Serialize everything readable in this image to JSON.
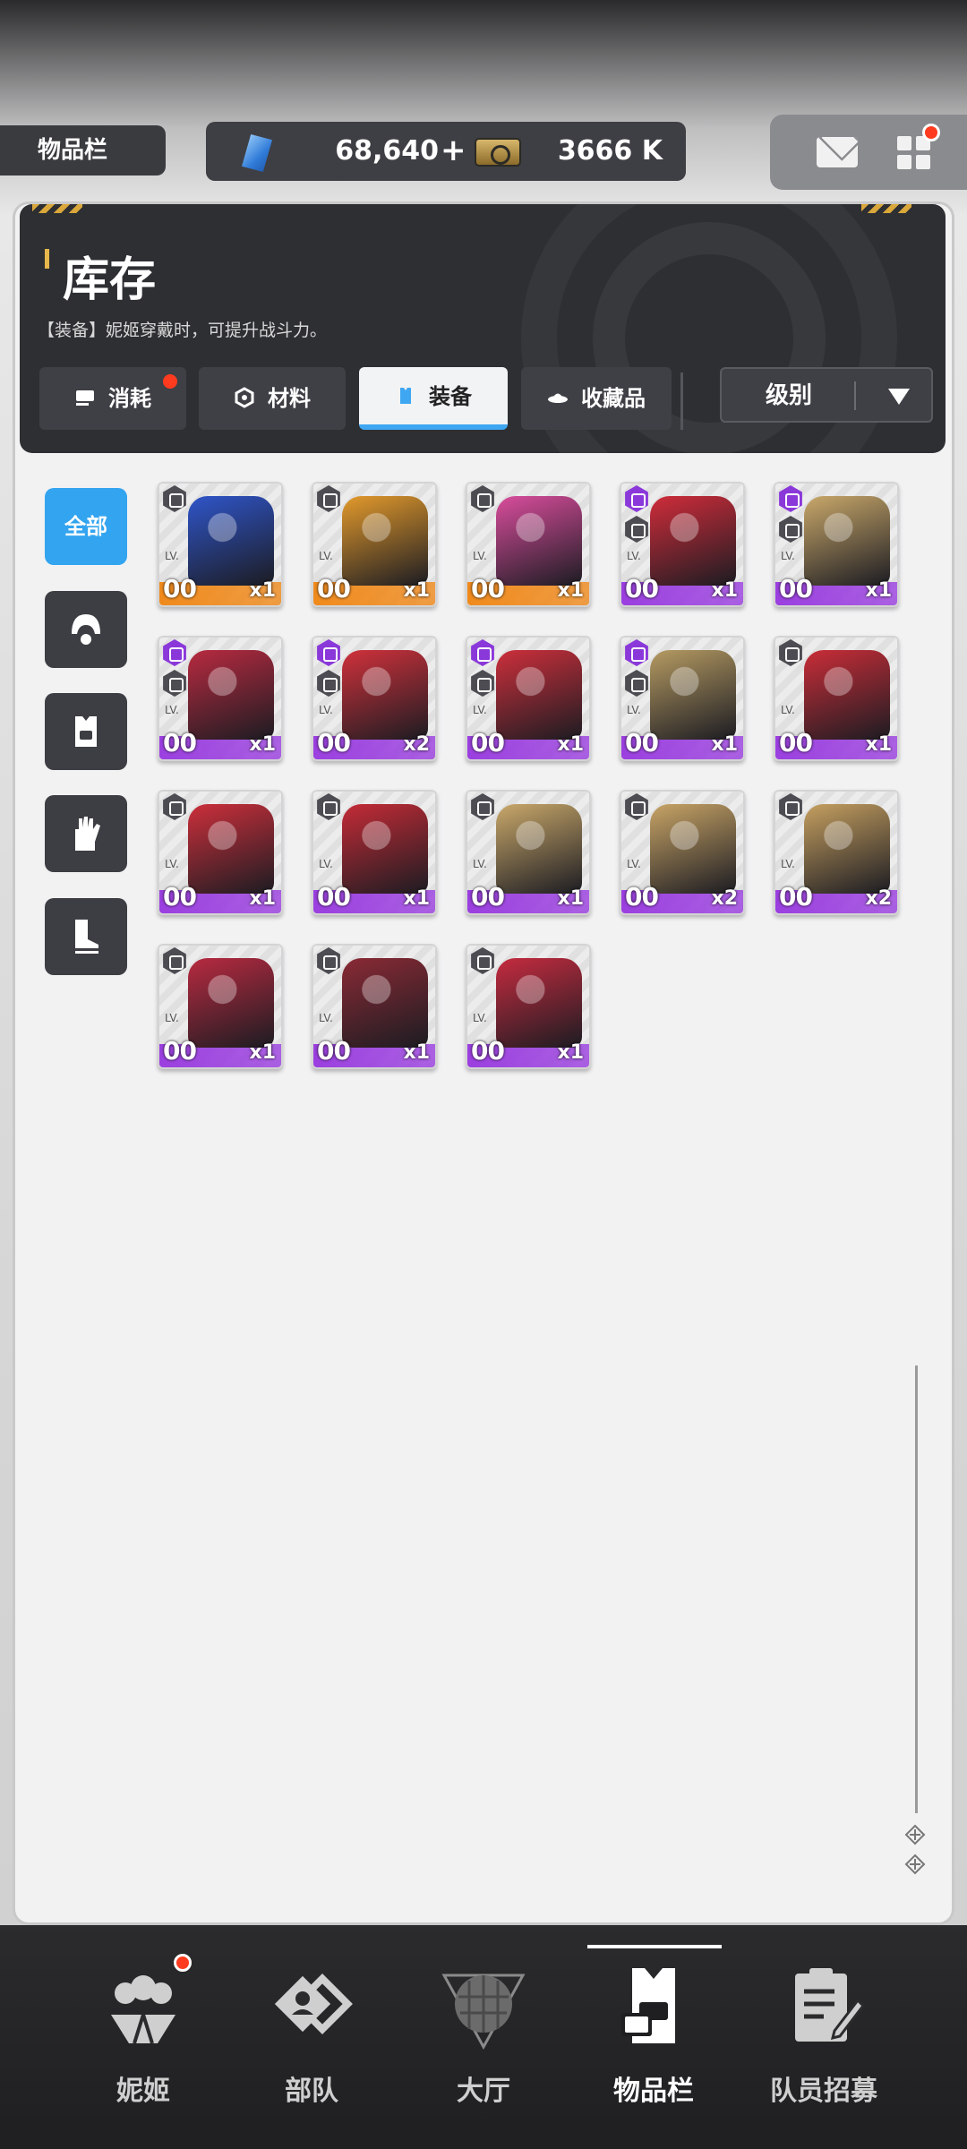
{
  "topbar": {
    "page_tag": "物品栏",
    "gems": "68,640",
    "plus": "+",
    "credits": "3666 K"
  },
  "header": {
    "title": "库存",
    "subtitle": "【装备】妮姬穿戴时，可提升战斗力。",
    "tabs": [
      {
        "label": "消耗",
        "icon": "consumable-icon",
        "active": false,
        "notify": true
      },
      {
        "label": "材料",
        "icon": "material-icon",
        "active": false,
        "notify": false
      },
      {
        "label": "装备",
        "icon": "equipment-icon",
        "active": true,
        "notify": false
      },
      {
        "label": "收藏品",
        "icon": "collection-icon",
        "active": false,
        "notify": false
      }
    ],
    "sort": {
      "label": "级别"
    }
  },
  "filters": [
    {
      "label": "全部",
      "icon": "all",
      "active": true
    },
    {
      "label": "",
      "icon": "helmet-icon",
      "active": false
    },
    {
      "label": "",
      "icon": "armor-icon",
      "active": false
    },
    {
      "label": "",
      "icon": "gloves-icon",
      "active": false
    },
    {
      "label": "",
      "icon": "boots-icon",
      "active": false
    }
  ],
  "items": [
    {
      "level": "00",
      "count": "x1",
      "rarity": "orange",
      "color": "#2f55c9",
      "badge_top": "gray"
    },
    {
      "level": "00",
      "count": "x1",
      "rarity": "orange",
      "color": "#e39a2c",
      "badge_top": "gray"
    },
    {
      "level": "00",
      "count": "x1",
      "rarity": "orange",
      "color": "#d94d9c",
      "badge_top": "gray"
    },
    {
      "level": "00",
      "count": "x1",
      "rarity": "purple",
      "color": "#cf2c3a",
      "badge_top": "purple"
    },
    {
      "level": "00",
      "count": "x1",
      "rarity": "purple",
      "color": "#c9a86a",
      "badge_top": "purple"
    },
    {
      "level": "00",
      "count": "x1",
      "rarity": "purple",
      "color": "#b82a40",
      "badge_top": "purple"
    },
    {
      "level": "00",
      "count": "x2",
      "rarity": "purple",
      "color": "#d0313b",
      "badge_top": "purple"
    },
    {
      "level": "00",
      "count": "x1",
      "rarity": "purple",
      "color": "#cc2f3b",
      "badge_top": "purple"
    },
    {
      "level": "00",
      "count": "x1",
      "rarity": "purple",
      "color": "#b59a62",
      "badge_top": "purple"
    },
    {
      "level": "00",
      "count": "x1",
      "rarity": "purple",
      "color": "#c92d38",
      "badge_top": "gray"
    },
    {
      "level": "00",
      "count": "x1",
      "rarity": "purple",
      "color": "#cc2f3b",
      "badge_top": "gray"
    },
    {
      "level": "00",
      "count": "x1",
      "rarity": "purple",
      "color": "#c42b36",
      "badge_top": "gray"
    },
    {
      "level": "00",
      "count": "x1",
      "rarity": "purple",
      "color": "#c9a86a",
      "badge_top": "gray"
    },
    {
      "level": "00",
      "count": "x2",
      "rarity": "purple",
      "color": "#c8a466",
      "badge_top": "gray"
    },
    {
      "level": "00",
      "count": "x2",
      "rarity": "purple",
      "color": "#c59f60",
      "badge_top": "gray"
    },
    {
      "level": "00",
      "count": "x1",
      "rarity": "purple",
      "color": "#b82a40",
      "badge_top": "gray"
    },
    {
      "level": "00",
      "count": "x1",
      "rarity": "purple",
      "color": "#8a2a35",
      "badge_top": "gray"
    },
    {
      "level": "00",
      "count": "x1",
      "rarity": "purple",
      "color": "#c52b3f",
      "badge_top": "gray"
    }
  ],
  "lv_label": "LV.",
  "nav": [
    {
      "label": "妮姬",
      "icon": "nikke-icon",
      "active": false,
      "notify": true
    },
    {
      "label": "部队",
      "icon": "squad-icon",
      "active": false,
      "notify": false
    },
    {
      "label": "大厅",
      "icon": "lobby-icon",
      "active": false,
      "notify": false
    },
    {
      "label": "物品栏",
      "icon": "inventory-icon",
      "active": true,
      "notify": false
    },
    {
      "label": "队员招募",
      "icon": "recruit-icon",
      "active": false,
      "notify": false
    }
  ],
  "colors": {
    "accent": "#33a4ef",
    "notify": "#ff3b1f",
    "rarity_purple": "#9b3fe0",
    "rarity_orange": "#f08a1c"
  }
}
